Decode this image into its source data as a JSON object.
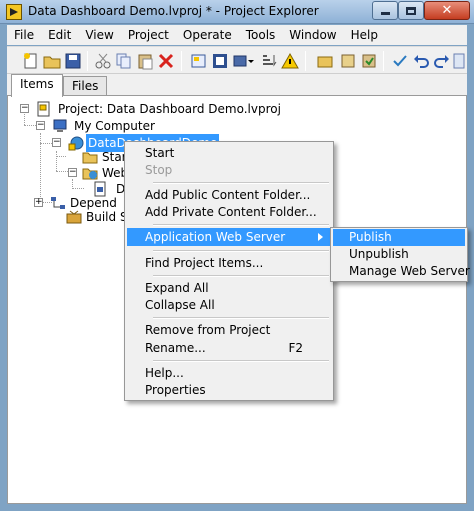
{
  "window": {
    "title": "Data Dashboard Demo.lvproj * - Project Explorer",
    "close_symbol": "✕"
  },
  "menubar": [
    "File",
    "Edit",
    "View",
    "Project",
    "Operate",
    "Tools",
    "Window",
    "Help"
  ],
  "tabs": [
    {
      "label": "Items",
      "active": true
    },
    {
      "label": "Files",
      "active": false
    }
  ],
  "tree": {
    "project": "Project: Data Dashboard Demo.lvproj",
    "my_computer": "My Computer",
    "service": "DataDashboardDemo",
    "startup_partial": "Start",
    "web_partial": "Web",
    "doc_partial": "D",
    "dependencies_partial": "Depend",
    "build_partial": "Build Sp",
    "expander_minus": "−",
    "expander_plus": "+"
  },
  "context_menu": {
    "items": [
      {
        "label": "Start",
        "disabled": false
      },
      {
        "label": "Stop",
        "disabled": true
      },
      {
        "label": "Add Public Content Folder...",
        "disabled": false
      },
      {
        "label": "Add Private Content Folder...",
        "disabled": false
      },
      {
        "label": "Application Web Server",
        "disabled": false,
        "highlighted": true,
        "submenu": true
      },
      {
        "label": "Find Project Items...",
        "disabled": false
      },
      {
        "label": "Expand All",
        "disabled": false
      },
      {
        "label": "Collapse All",
        "disabled": false
      },
      {
        "label": "Remove from Project",
        "disabled": false
      },
      {
        "label": "Rename...",
        "disabled": false,
        "shortcut": "F2"
      },
      {
        "label": "Help...",
        "disabled": false
      },
      {
        "label": "Properties",
        "disabled": false
      }
    ]
  },
  "submenu": {
    "items": [
      {
        "label": "Publish",
        "highlighted": true
      },
      {
        "label": "Unpublish",
        "highlighted": false
      },
      {
        "label": "Manage Web Server",
        "highlighted": false
      }
    ]
  },
  "colors": {
    "selection": "#3399ff",
    "menu_bg": "#f0f0f0",
    "frame": "#7fa3c4"
  }
}
